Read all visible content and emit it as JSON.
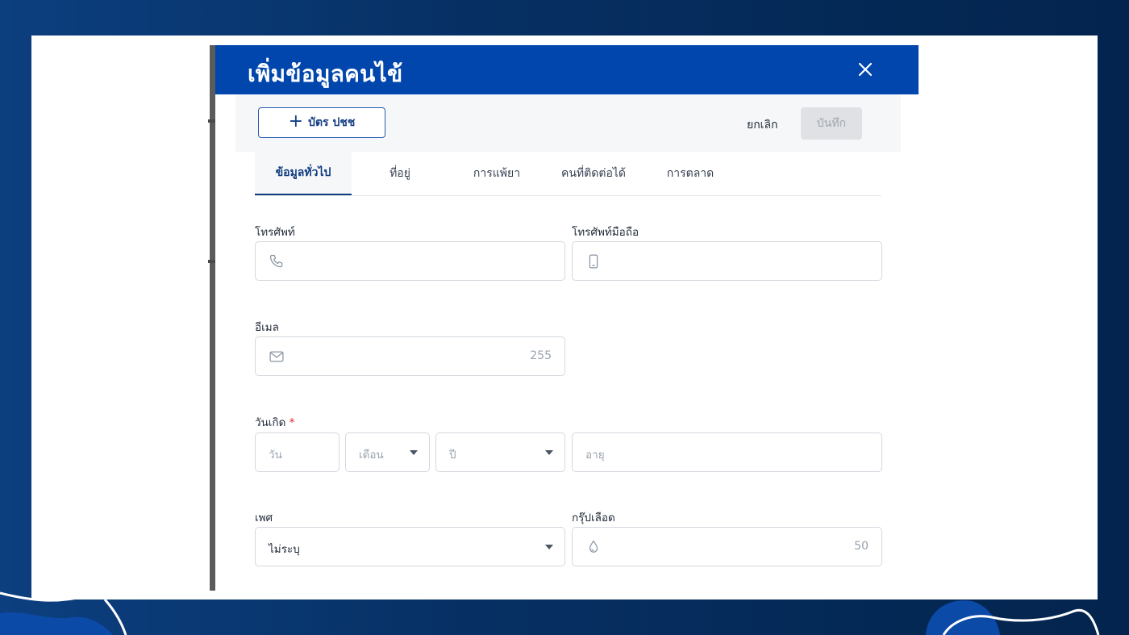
{
  "modal": {
    "title": "เพิ่มข้อมูลคนไข้",
    "close_icon": "close-icon"
  },
  "actions": {
    "id_card_button": "บัตร ปชช",
    "id_card_icon": "plus-icon",
    "cancel_button": "ยกเลิก",
    "save_button": "บันทึก"
  },
  "tabs": [
    {
      "label": "ข้อมูลทั่วไป",
      "active": true
    },
    {
      "label": "ที่อยู่",
      "active": false
    },
    {
      "label": "การแพ้ยา",
      "active": false
    },
    {
      "label": "คนที่ติดต่อได้",
      "active": false
    },
    {
      "label": "การตลาด",
      "active": false
    }
  ],
  "form": {
    "phone": {
      "label": "โทรศัพท์",
      "icon": "phone-icon",
      "value": ""
    },
    "mobile": {
      "label": "โทรศัพท์มือถือ",
      "icon": "mobile-phone-icon",
      "value": ""
    },
    "email": {
      "label": "อีเมล",
      "icon": "mail-icon",
      "value": "",
      "char_count": "255"
    },
    "birthdate": {
      "label": "วันเกิด",
      "required_mark": "*",
      "day_placeholder": "วัน",
      "month_placeholder": "เดือน",
      "year_placeholder": "ปี",
      "age_placeholder": "อายุ"
    },
    "gender": {
      "label": "เพศ",
      "value": "ไม่ระบุ"
    },
    "blood_group": {
      "label": "กรุ๊ปเลือด",
      "icon": "droplet-icon",
      "value": "",
      "char_count": "50"
    }
  },
  "colors": {
    "header": "#0046ad",
    "accent": "#0f3d80",
    "required": "#e02424",
    "background_dark": "#03244d"
  }
}
